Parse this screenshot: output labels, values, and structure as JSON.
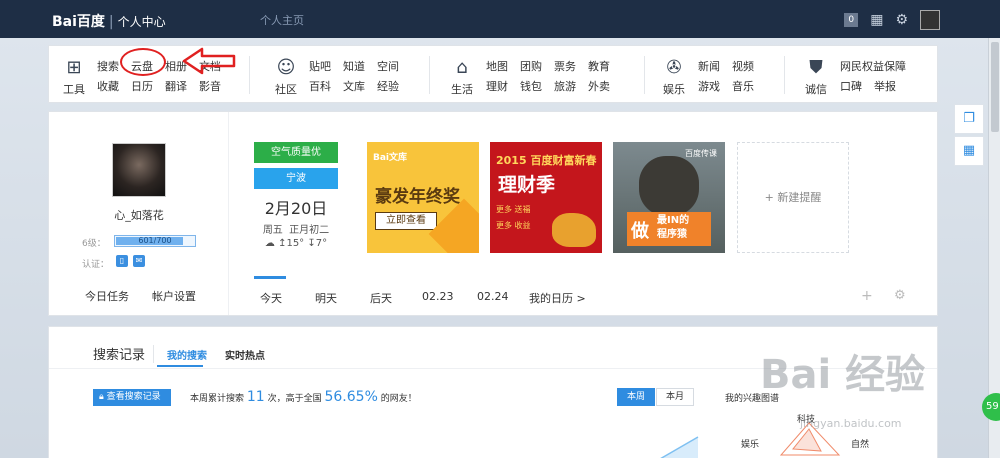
{
  "header": {
    "logo_text": "Bai百度",
    "logo_paw": "",
    "section": "个人中心",
    "home_link": "个人主页",
    "message_count": "0"
  },
  "nav": {
    "tools": {
      "label": "工具",
      "items": [
        "搜索",
        "收藏",
        "云盘",
        "日历",
        "相册",
        "翻译",
        "文档",
        "影音"
      ]
    },
    "community": {
      "label": "社区",
      "items": [
        "贴吧",
        "百科",
        "知道",
        "文库",
        "空间",
        "经验"
      ]
    },
    "life": {
      "label": "生活",
      "items": [
        "地图",
        "理财",
        "团购",
        "钱包",
        "票务",
        "旅游",
        "教育",
        "外卖"
      ]
    },
    "ent": {
      "label": "娱乐",
      "items": [
        "新闻",
        "游戏",
        "视频",
        "音乐"
      ]
    },
    "trust": {
      "label": "诚信",
      "items": [
        "网民权益保障",
        "口碑",
        "举报"
      ]
    }
  },
  "profile": {
    "username": "心_如落花",
    "level_label": "6级：",
    "level_progress": "601/700",
    "level_fraction": 0.8586,
    "verify_label": "认证：",
    "tasks_link": "今日任务",
    "settings_link": "帐户设置"
  },
  "weather": {
    "aqi": "空气质量优",
    "city": "宁波",
    "date": "2月20日",
    "weekday": "周五",
    "lunar": "正月初二",
    "temp": "↥15° ↧7°"
  },
  "banners": {
    "b1": {
      "brand": "Bai文库",
      "title": "豪发年终奖",
      "button": "立即查看"
    },
    "b2": {
      "line1": "2015 百度财富新春",
      "title": "理财季",
      "line3": "更多 送福",
      "line4": "更多 收益"
    },
    "b3": {
      "brand": "百度传课",
      "big": "做",
      "small": "最IN的\n程序猿"
    },
    "new_reminder": "+ 新建提醒"
  },
  "calendar_tabs": [
    "今天",
    "明天",
    "后天",
    "02.23",
    "02.24",
    "我的日历 >"
  ],
  "search_record": {
    "title": "搜索记录",
    "tab_mine": "我的搜索",
    "tab_hot": "实时热点",
    "view_button": "查看搜索记录",
    "stats_prefix": "本周累计搜索",
    "stats_count": "11",
    "stats_mid": "次，高于全国",
    "stats_pct": "56.65%",
    "stats_suffix": "的网友！",
    "week_this": "本周",
    "week_month": "本月",
    "interest_title": "我的兴趣图谱",
    "radar_labels": {
      "tech": "科技",
      "ent": "娱乐",
      "nature": "自然"
    }
  },
  "watermark": {
    "logo": "Bai 经验",
    "url": "jingyan.baidu.com"
  },
  "float_badge": "59"
}
